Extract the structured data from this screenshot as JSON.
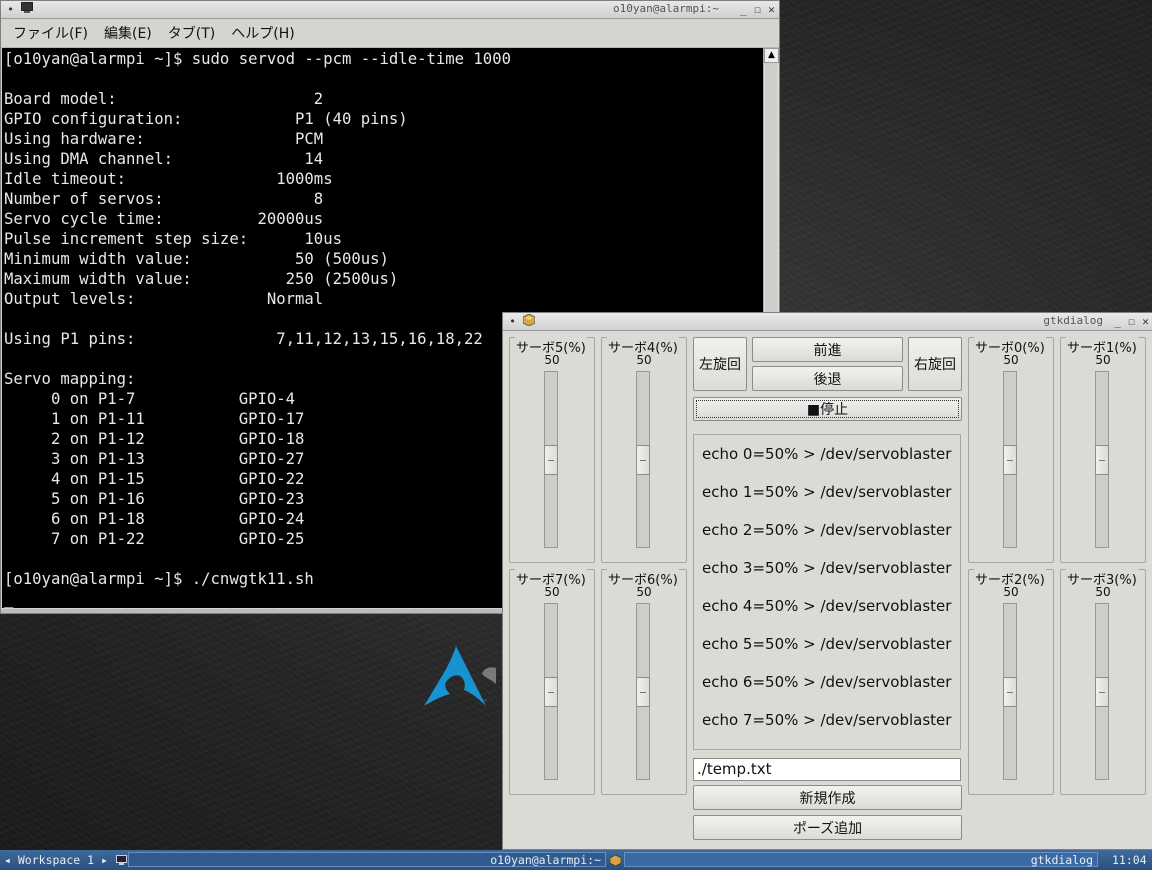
{
  "terminal": {
    "title": "o10yan@alarmpi:~",
    "menu": [
      "ファイル(F)",
      "編集(E)",
      "タブ(T)",
      "ヘルプ(H)"
    ],
    "lines": [
      "[o10yan@alarmpi ~]$ sudo servod --pcm --idle-time 1000",
      "",
      "Board model:                     2",
      "GPIO configuration:            P1 (40 pins)",
      "Using hardware:                PCM",
      "Using DMA channel:              14",
      "Idle timeout:                1000ms",
      "Number of servos:                8",
      "Servo cycle time:          20000us",
      "Pulse increment step size:      10us",
      "Minimum width value:           50 (500us)",
      "Maximum width value:          250 (2500us)",
      "Output levels:              Normal",
      "",
      "Using P1 pins:               7,11,12,13,15,16,18,22",
      "",
      "Servo mapping:",
      "     0 on P1-7           GPIO-4",
      "     1 on P1-11          GPIO-17",
      "     2 on P1-12          GPIO-18",
      "     3 on P1-13          GPIO-27",
      "     4 on P1-15          GPIO-22",
      "     5 on P1-16          GPIO-23",
      "     6 on P1-18          GPIO-24",
      "     7 on P1-22          GPIO-25",
      "",
      "[o10yan@alarmpi ~]$ ./cnwgtk11.sh",
      "_"
    ]
  },
  "gtk": {
    "title": "gtkdialog",
    "sliders": [
      {
        "label": "サーボ5(%)",
        "value": "50",
        "level": 0.5
      },
      {
        "label": "サーボ4(%)",
        "value": "50",
        "level": 0.5
      },
      {
        "label": "サーボ7(%)",
        "value": "50",
        "level": 0.5
      },
      {
        "label": "サーボ6(%)",
        "value": "50",
        "level": 0.5
      },
      {
        "label": "サーボ0(%)",
        "value": "50",
        "level": 0.5
      },
      {
        "label": "サーボ1(%)",
        "value": "50",
        "level": 0.5
      },
      {
        "label": "サーボ2(%)",
        "value": "50",
        "level": 0.5
      },
      {
        "label": "サーボ3(%)",
        "value": "50",
        "level": 0.5
      }
    ],
    "buttons": {
      "left_turn": "左旋回",
      "forward": "前進",
      "backward": "後退",
      "right_turn": "右旋回",
      "stop": "■停止",
      "new": "新規作成",
      "add_pose": "ポーズ追加"
    },
    "echo_lines": [
      "echo 0=50% > /dev/servoblaster",
      "echo 1=50% > /dev/servoblaster",
      "echo 2=50% > /dev/servoblaster",
      "echo 3=50% > /dev/servoblaster",
      "echo 4=50% > /dev/servoblaster",
      "echo 5=50% > /dev/servoblaster",
      "echo 6=50% > /dev/servoblaster",
      "echo 7=50% > /dev/servoblaster"
    ],
    "filename": "./temp.txt"
  },
  "taskbar": {
    "workspace": "Workspace 1",
    "task_terminal": "o10yan@alarmpi:~",
    "task_gtk": "gtkdialog",
    "clock": "11:04"
  }
}
